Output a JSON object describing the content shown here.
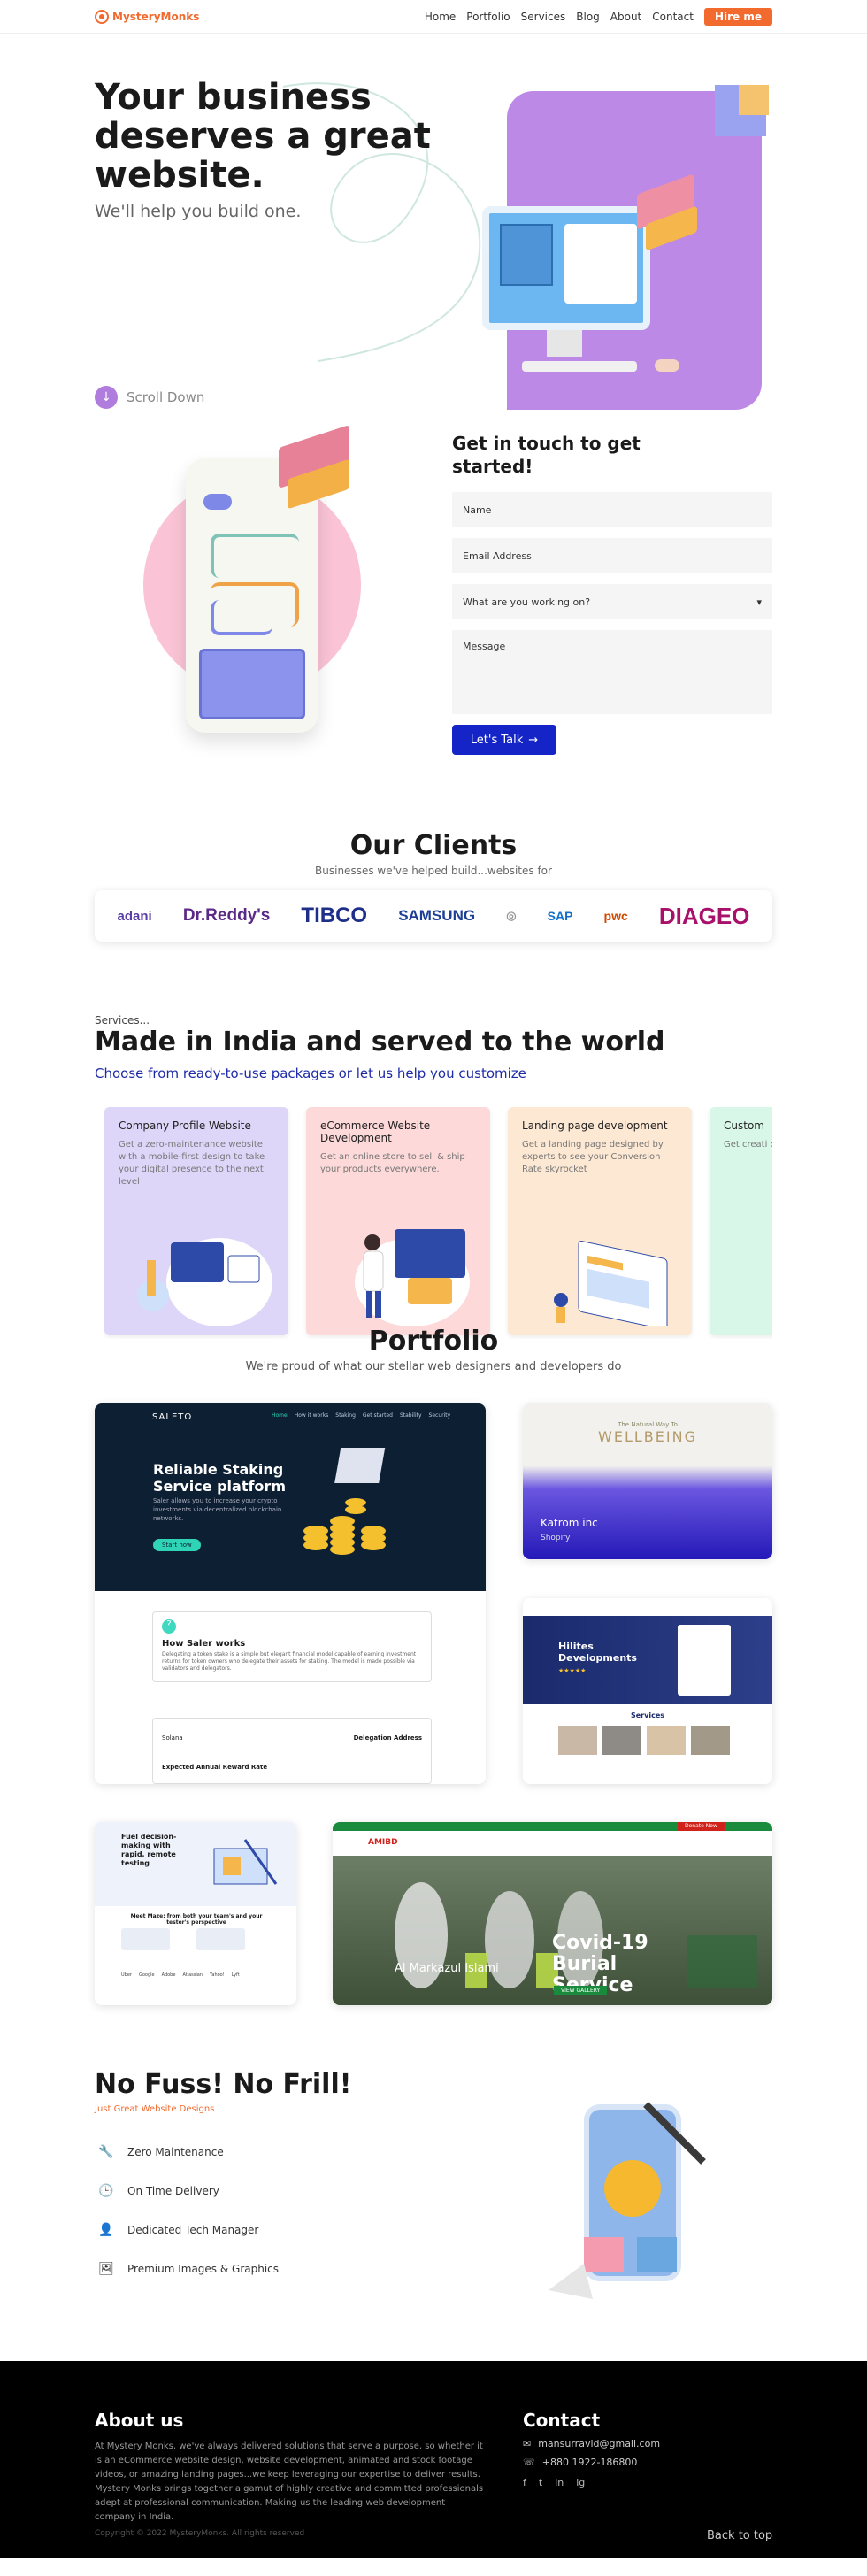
{
  "header": {
    "brand": "MysteryMonks",
    "nav": [
      "Home",
      "Portfolio",
      "Services",
      "Blog",
      "About",
      "Contact"
    ],
    "cta": "Hire me"
  },
  "hero": {
    "title": "Your business deserves a great website.",
    "subtitle": "We'll help you build one.",
    "scroll_label": "Scroll Down"
  },
  "contact_form": {
    "heading": "Get in touch to get started!",
    "name_placeholder": "Name",
    "email_placeholder": "Email Address",
    "topic_placeholder": "What are you working on?",
    "message_placeholder": "Message",
    "submit_label": "Let's Talk",
    "submit_arrow": "→"
  },
  "clients": {
    "title": "Our Clients",
    "tagline": "Businesses we've helped build...websites for",
    "logos": [
      {
        "name": "adani",
        "color": "#5a3ea8"
      },
      {
        "name": "Dr.Reddy's",
        "color": "#5b2a86"
      },
      {
        "name": "TIBCO",
        "color": "#1e2f8a"
      },
      {
        "name": "SAMSUNG",
        "color": "#1c3f94"
      },
      {
        "name": "◎",
        "color": "#999999"
      },
      {
        "name": "SAP",
        "color": "#0f6fca"
      },
      {
        "name": "pwc",
        "color": "#d04a02"
      },
      {
        "name": "DIAGEO",
        "color": "#a8116a"
      }
    ]
  },
  "services": {
    "pre": "Services...",
    "title": "Made in India and served to the world",
    "lead": "Choose from ready-to-use packages or let us help you customize",
    "cards": [
      {
        "title": "Company Profile Website",
        "desc": "Get a zero-maintenance website with a mobile-first design to take your digital presence to the next level",
        "bg": "#ddd6f9"
      },
      {
        "title": "eCommerce Website Development",
        "desc": "Get an online store to sell & ship your products everywhere.",
        "bg": "#fdd9d9"
      },
      {
        "title": "Landing page development",
        "desc": "Get a landing page designed by experts to see your Conversion Rate skyrocket",
        "bg": "#fde8d3"
      },
      {
        "title": "Custom",
        "desc": "Get creati customize develop",
        "bg": "#d9f7e9"
      }
    ]
  },
  "portfolio": {
    "title": "Portfolio",
    "tagline": "We're proud of what our stellar web designers and developers do",
    "items": {
      "saleto": {
        "brand": "SALETO",
        "nav": [
          "Home",
          "How it works",
          "Staking",
          "Get started",
          "Stability",
          "Security"
        ],
        "headline": "Reliable Staking Service platform",
        "body": "Saler allows you to increase your crypto investments via decentralized blockchain networks.",
        "button": "Start now",
        "card_title": "How Saler works",
        "card_body": "Delegating a token stake is a simple but elegant financial model capable of earning investment returns for token owners who delegate their assets for staking. The model is made possible via validators and delegators.",
        "panel_left": "Solana",
        "panel_right": "Delegation Address",
        "panel_bottom": "Expected Annual Reward Rate"
      },
      "katrom": {
        "pre": "The Natural Way To",
        "heading": "WELLBEING",
        "title": "Katrom inc",
        "tag": "Shopify"
      },
      "hilites": {
        "title": "Hilites Developments",
        "section": "Services",
        "stars": "★★★★★"
      },
      "fuel": {
        "title": "Fuel decision-making with rapid, remote testing",
        "mid": "Meet Maze: from both your team's and your tester's perspective",
        "brands": [
          "Uber",
          "Google",
          "Adobe",
          "Atlassian",
          "Yahoo!",
          "Lyft"
        ]
      },
      "amibd": {
        "logo": "AMIBD",
        "headline": "Covid-19 Burial Service",
        "sub": "Al Markazul Islami",
        "button": "VIEW GALLERY",
        "donate": "Donate Now"
      }
    }
  },
  "features": {
    "title": "No Fuss! No Frill!",
    "tagline": "Just Great Website Designs",
    "items": [
      {
        "icon": "wrench-icon",
        "glyph": "🔧",
        "label": "Zero Maintenance"
      },
      {
        "icon": "clock-icon",
        "glyph": "🕒",
        "label": "On Time Delivery"
      },
      {
        "icon": "person-icon",
        "glyph": "👤",
        "label": "Dedicated Tech Manager"
      },
      {
        "icon": "image-icon",
        "glyph": "🖼",
        "label": "Premium Images & Graphics"
      }
    ]
  },
  "footer": {
    "about_title": "About us",
    "about_text": "At Mystery Monks, we've always delivered solutions that serve a purpose, so whether it is an eCommerce website design, website development, animated and stock footage videos, or amazing landing pages...we keep leveraging our expertise to deliver results. Mystery Monks brings together a gamut of highly creative and committed professionals adept at professional communication. Making us the leading web development company in India.",
    "contact_title": "Contact",
    "email": "mansurravid@gmail.com",
    "phone": "+880 1922-186800",
    "social": [
      "f",
      "t",
      "in",
      "ig"
    ],
    "copyright": "Copyright © 2022 MysteryMonks. All rights reserved",
    "back_to_top": "Back to top"
  },
  "colors": {
    "brand_orange": "#f26a2e",
    "cta_blue": "#1424c6",
    "purple": "#bd89e6",
    "footer_bg": "#000000"
  }
}
